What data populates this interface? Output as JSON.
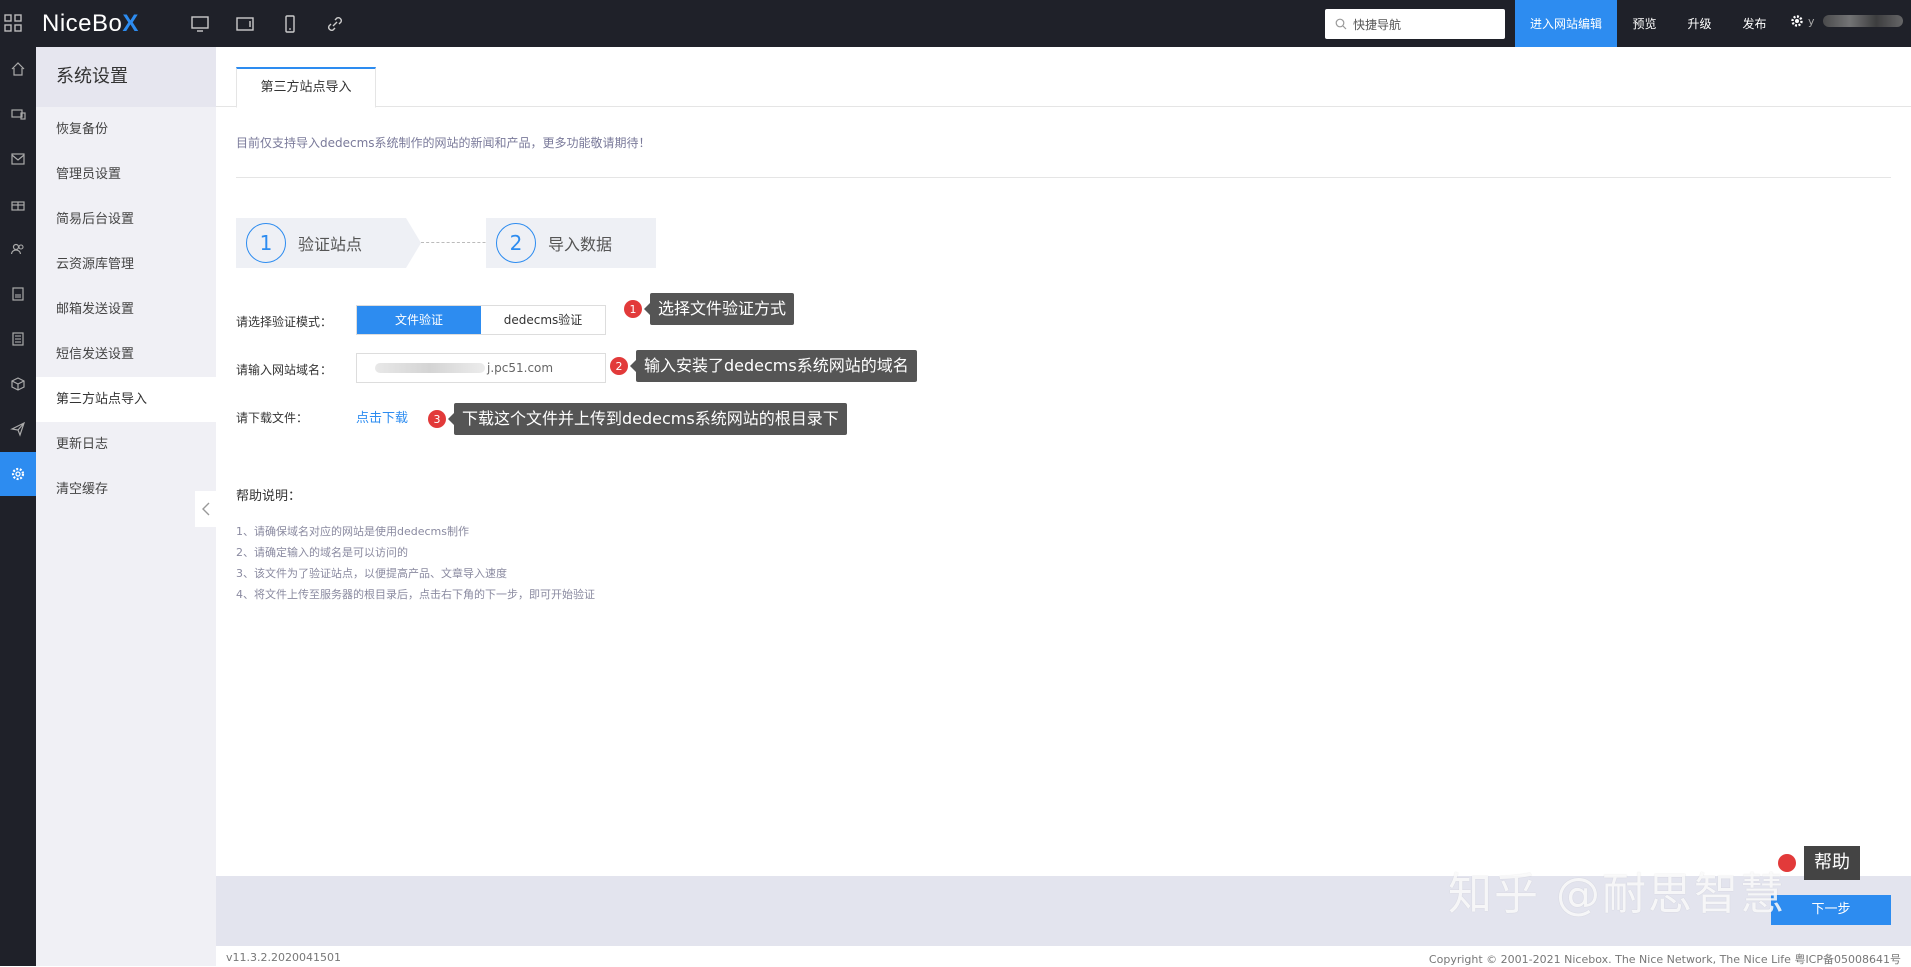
{
  "topbar": {
    "brand_text": "NiceBo",
    "brand_x": "X",
    "search_placeholder": "快捷导航",
    "buttons": {
      "edit": "进入网站编辑",
      "preview": "预览",
      "upgrade": "升级",
      "publish": "发布"
    },
    "user_initial": "y"
  },
  "submenu": {
    "title": "系统设置",
    "items": [
      {
        "label": "恢复备份"
      },
      {
        "label": "管理员设置"
      },
      {
        "label": "简易后台设置"
      },
      {
        "label": "云资源库管理"
      },
      {
        "label": "邮箱发送设置"
      },
      {
        "label": "短信发送设置"
      },
      {
        "label": "第三方站点导入"
      },
      {
        "label": "更新日志"
      },
      {
        "label": "清空缓存"
      }
    ]
  },
  "main": {
    "tab_label": "第三方站点导入",
    "notice": "目前仅支持导入dedecms系统制作的网站的新闻和产品，更多功能敬请期待！",
    "steps": [
      {
        "num": "1",
        "label": "验证站点"
      },
      {
        "num": "2",
        "label": "导入数据"
      }
    ],
    "form": {
      "mode_label": "请选择验证模式：",
      "mode_options": [
        "文件验证",
        "dedecms验证"
      ],
      "domain_label": "请输入网站域名：",
      "domain_value": "j.pc51.com",
      "file_label": "请下载文件：",
      "download_link": "点击下载"
    },
    "callouts": [
      {
        "num": "1",
        "text": "选择文件验证方式"
      },
      {
        "num": "2",
        "text": "输入安装了dedecms系统网站的域名"
      },
      {
        "num": "3",
        "text": "下载这个文件并上传到dedecms系统网站的根目录下"
      }
    ],
    "help": {
      "title": "帮助说明：",
      "lines": [
        "1、请确保域名对应的网站是使用dedecms制作",
        "2、请确定输入的域名是可以访问的",
        "3、该文件为了验证站点，以便提高产品、文章导入速度",
        "4、将文件上传至服务器的根目录后，点击右下角的下一步，即可开始验证"
      ]
    },
    "next_button": "下一步",
    "watermark": "知乎 @耐思智慧",
    "help_float": "帮助"
  },
  "footer": {
    "version": "v11.3.2.2020041501",
    "copyright": "Copyright © 2001-2021 Nicebox. The Nice Network, The Nice Life   粤ICP备05008641号"
  },
  "colors": {
    "accent": "#2d8cf0",
    "topbar_bg": "#1f2129",
    "callout_red": "#e23a3a"
  }
}
